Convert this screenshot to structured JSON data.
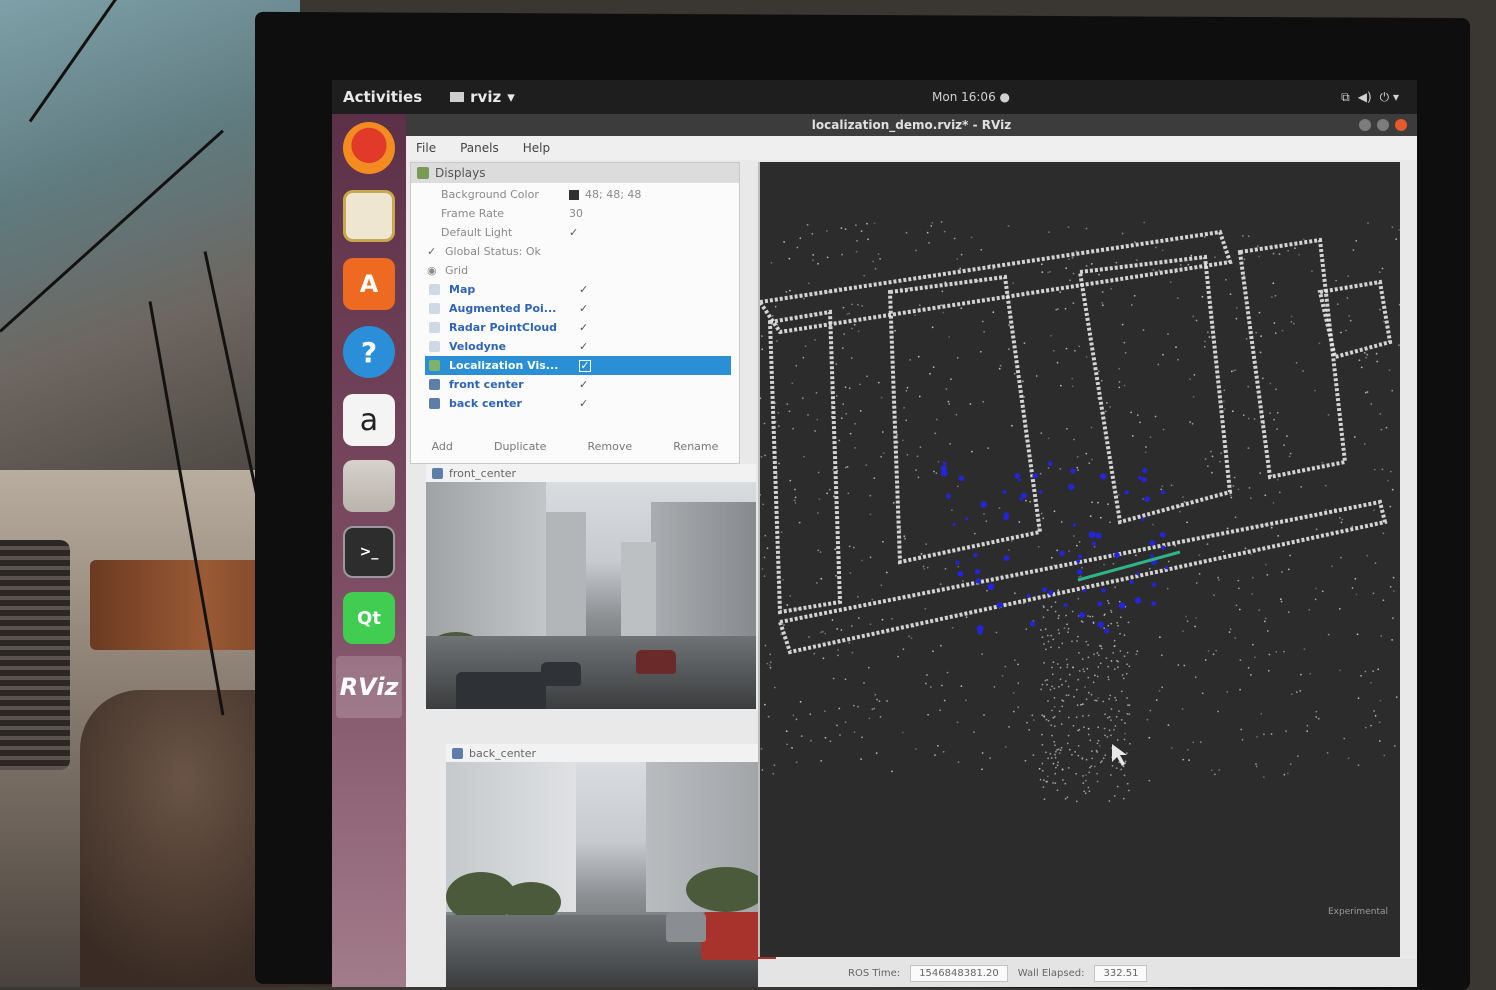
{
  "colors": {
    "topbar": "#1e1e1e",
    "launcher_top": "#5c3148",
    "selection": "#2b8fd6",
    "view_background": "#2c2c2c",
    "point_cloud": "#e6e6e6",
    "localization_points": "#2424d8",
    "path_line": "#2fb38a"
  },
  "topbar": {
    "activities": "Activities",
    "app_name": "rviz",
    "clock": "Mon 16:06 ●",
    "icons": [
      "network-icon",
      "volume-icon",
      "power-icon"
    ]
  },
  "launcher": [
    {
      "name": "firefox",
      "icon": "firefox-icon"
    },
    {
      "name": "sound-recorder",
      "icon": "speaker-icon"
    },
    {
      "name": "software-center",
      "icon": "shopping-bag-icon"
    },
    {
      "name": "help",
      "icon": "help-icon"
    },
    {
      "name": "amazon",
      "icon": "amazon-icon"
    },
    {
      "name": "file-manager",
      "icon": "files-icon"
    },
    {
      "name": "terminal",
      "icon": "terminal-icon"
    },
    {
      "name": "qt-creator",
      "icon": "qt-icon"
    },
    {
      "name": "rviz",
      "icon": "rviz-icon",
      "label": "RViz"
    }
  ],
  "window": {
    "title": "localization_demo.rviz* - RViz"
  },
  "menu": [
    "File",
    "Panels",
    "Help"
  ],
  "displays": {
    "title": "Displays",
    "rows": [
      {
        "label": "Background Color",
        "value": "48; 48; 48",
        "indent": 1
      },
      {
        "label": "Frame Rate",
        "value": "30",
        "indent": 1
      },
      {
        "label": "Default Light",
        "check": "✓",
        "indent": 1
      },
      {
        "label": "Global Status: Ok",
        "prefix": "✓",
        "indent": 0
      },
      {
        "label": "Grid",
        "indent": 0
      },
      {
        "label": "Map",
        "check": "✓",
        "indent": 0,
        "blue": true
      },
      {
        "label": "Augmented Poi...",
        "check": "✓",
        "indent": 0,
        "blue": true
      },
      {
        "label": "Radar PointCloud",
        "check": "✓",
        "indent": 0,
        "blue": true
      },
      {
        "label": "Velodyne",
        "check": "✓",
        "indent": 0,
        "blue": true
      },
      {
        "label": "Localization Vis...",
        "check": "✓",
        "indent": 0,
        "selected": true
      },
      {
        "label": "front center",
        "check": "✓",
        "indent": 0,
        "blue": true
      },
      {
        "label": "back center",
        "check": "✓",
        "indent": 0,
        "blue": true
      }
    ],
    "buttons": [
      "Add",
      "Duplicate",
      "Remove",
      "Rename"
    ]
  },
  "image_panels": [
    {
      "title": "front_center"
    },
    {
      "title": "back_center"
    }
  ],
  "status": {
    "ros_time_label": "ROS Time:",
    "ros_time": "1546848381.20",
    "wall_elapsed_label": "Wall Elapsed:",
    "wall_elapsed": "332.51",
    "experimental": "Experimental"
  }
}
